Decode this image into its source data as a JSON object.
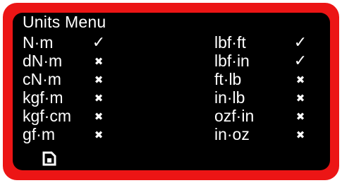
{
  "window": {
    "title": "Units Menu"
  },
  "left_units": [
    {
      "label": "N·m",
      "status": "selected",
      "mark": "✓"
    },
    {
      "label": "dN·m",
      "status": "unselected",
      "mark": "✖"
    },
    {
      "label": "cN·m",
      "status": "unselected",
      "mark": "✖"
    },
    {
      "label": "kgf·m",
      "status": "unselected",
      "mark": "✖"
    },
    {
      "label": "kgf·cm",
      "status": "unselected",
      "mark": "✖"
    },
    {
      "label": "gf·m",
      "status": "unselected",
      "mark": "✖"
    }
  ],
  "right_units": [
    {
      "label": "lbf·ft",
      "status": "selected",
      "mark": "✓"
    },
    {
      "label": "lbf·in",
      "status": "selected",
      "mark": "✓"
    },
    {
      "label": "ft·lb",
      "status": "unselected",
      "mark": "✖"
    },
    {
      "label": "in·lb",
      "status": "unselected",
      "mark": "✖"
    },
    {
      "label": "ozf·in",
      "status": "unselected",
      "mark": "✖"
    },
    {
      "label": "in·oz",
      "status": "unselected",
      "mark": "✖"
    }
  ],
  "footer": {
    "icon": "save-icon"
  },
  "colors": {
    "frame": "#ec1515",
    "screen": "#000000",
    "text": "#ffffff"
  }
}
